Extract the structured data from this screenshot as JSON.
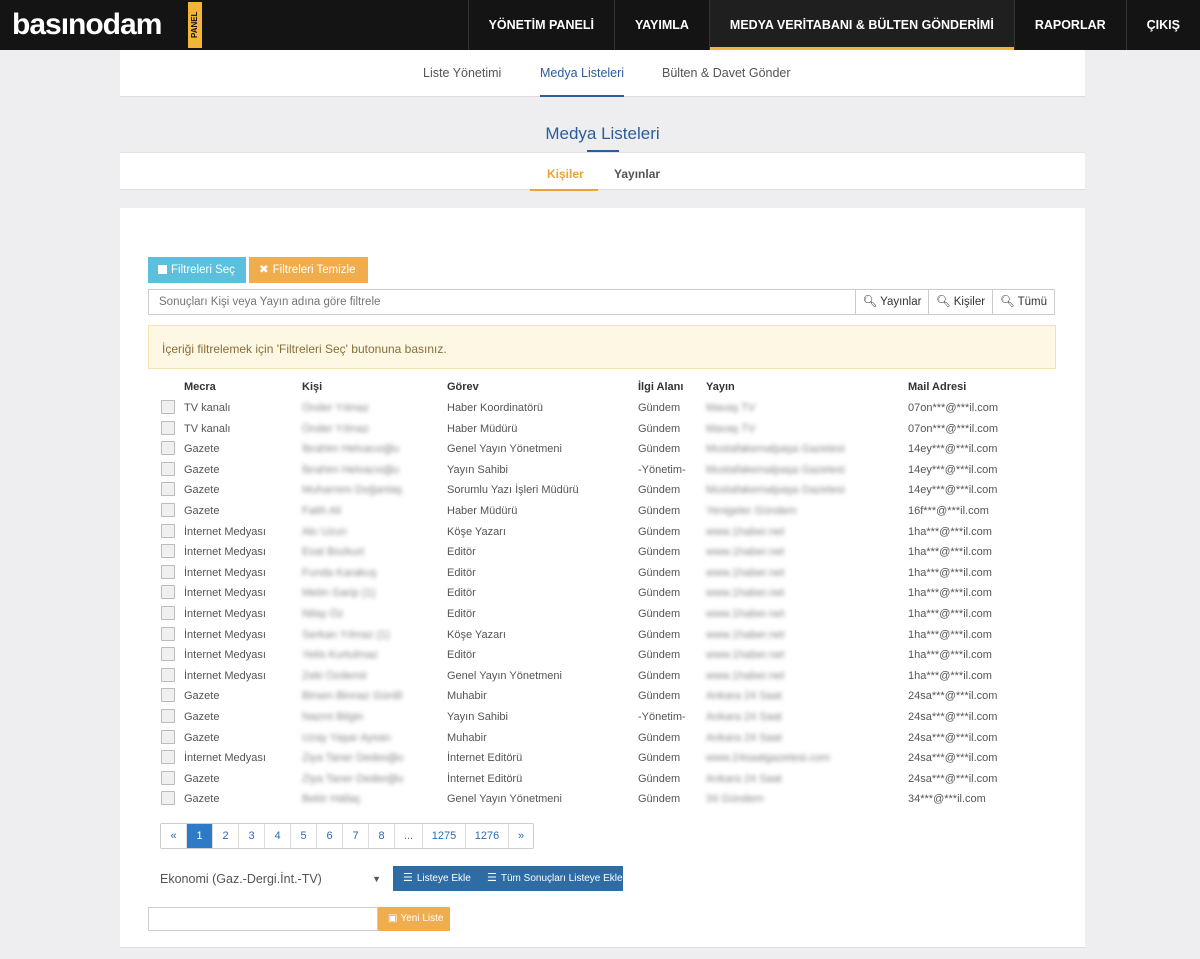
{
  "brand": {
    "logo": "basınodam",
    "badge": "PANEL"
  },
  "nav": [
    "YÖNETİM PANELİ",
    "YAYIMLA",
    "MEDYA VERİTABANI & BÜLTEN GÖNDERİMİ",
    "RAPORLAR",
    "ÇIKIŞ"
  ],
  "subtabs": [
    "Liste Yönetimi",
    "Medya Listeleri",
    "Bülten & Davet Gönder"
  ],
  "page_title": "Medya Listeleri",
  "tabs": [
    "Kişiler",
    "Yayınlar"
  ],
  "buttons": {
    "select_filters": "Filtreleri Seç",
    "clear_filters": "Filtreleri Temizle",
    "add_to_list": "Listeye Ekle",
    "add_all": "Tüm Sonuçları Listeye Ekle",
    "new_list": "Yeni Liste"
  },
  "search": {
    "placeholder": "Sonuçları Kişi veya Yayın adına göre filtrele",
    "btn_publications": "Yayınlar",
    "btn_people": "Kişiler",
    "btn_all": "Tümü"
  },
  "alert": "İçeriği filtrelemek için 'Filtreleri Seç' butonuna basınız.",
  "columns": [
    "Mecra",
    "Kişi",
    "Görev",
    "İlgi Alanı",
    "Yayın",
    "Mail Adresi"
  ],
  "rows": [
    [
      "TV kanalı",
      "Önder Yılmaz",
      "Haber Koordinatörü",
      "Gündem",
      "Mavaş TV",
      "07on***@***il.com"
    ],
    [
      "TV kanalı",
      "Önder Yılmaz",
      "Haber Müdürü",
      "Gündem",
      "Mavaş TV",
      "07on***@***il.com"
    ],
    [
      "Gazete",
      "İbrahim Helvacıoğlu",
      "Genel Yayın Yönetmeni",
      "Gündem",
      "Mustafakemalpaşa Gazetesi",
      "14ey***@***il.com"
    ],
    [
      "Gazete",
      "İbrahim Helvacıoğlu",
      "Yayın Sahibi",
      "-Yönetim-",
      "Mustafakemalpaşa Gazetesi",
      "14ey***@***il.com"
    ],
    [
      "Gazete",
      "Muharrem Doğantaş",
      "Sorumlu Yazı İşleri Müdürü",
      "Gündem",
      "Mustafakemalpaşa Gazetesi",
      "14ey***@***il.com"
    ],
    [
      "Gazete",
      "Fatih Ali",
      "Haber Müdürü",
      "Gündem",
      "Yenigeler Gündem",
      "16f***@***il.com"
    ],
    [
      "İnternet Medyası",
      "Akı Uzun",
      "Köşe Yazarı",
      "Gündem",
      "www.1haber.net",
      "1ha***@***il.com"
    ],
    [
      "İnternet Medyası",
      "Esat Bozkurt",
      "Editör",
      "Gündem",
      "www.1haber.net",
      "1ha***@***il.com"
    ],
    [
      "İnternet Medyası",
      "Funda Karakuş",
      "Editör",
      "Gündem",
      "www.1haber.net",
      "1ha***@***il.com"
    ],
    [
      "İnternet Medyası",
      "Metin Garip (1)",
      "Editör",
      "Gündem",
      "www.1haber.net",
      "1ha***@***il.com"
    ],
    [
      "İnternet Medyası",
      "Nilay Öz",
      "Editör",
      "Gündem",
      "www.1haber.net",
      "1ha***@***il.com"
    ],
    [
      "İnternet Medyası",
      "Serkan Yılmaz (1)",
      "Köşe Yazarı",
      "Gündem",
      "www.1haber.net",
      "1ha***@***il.com"
    ],
    [
      "İnternet Medyası",
      "Yetis Kurtulmaz",
      "Editör",
      "Gündem",
      "www.1haber.net",
      "1ha***@***il.com"
    ],
    [
      "İnternet Medyası",
      "Zeki Özdemir",
      "Genel Yayın Yönetmeni",
      "Gündem",
      "www.1haber.net",
      "1ha***@***il.com"
    ],
    [
      "Gazete",
      "Birsen Binnaz Gürdil",
      "Muhabir",
      "Gündem",
      "Ankara 24 Saat",
      "24sa***@***il.com"
    ],
    [
      "Gazete",
      "Nazmi Bilgin",
      "Yayın Sahibi",
      "-Yönetim-",
      "Ankara 24 Saat",
      "24sa***@***il.com"
    ],
    [
      "Gazete",
      "Uzay Yaşar Aysan",
      "Muhabir",
      "Gündem",
      "Ankara 24 Saat",
      "24sa***@***il.com"
    ],
    [
      "İnternet Medyası",
      "Ziya Taner Dedeoğlu",
      "İnternet Editörü",
      "Gündem",
      "www.24saatgazetesi.com",
      "24sa***@***il.com"
    ],
    [
      "Gazete",
      "Ziya Taner Dedeoğlu",
      "İnternet Editörü",
      "Gündem",
      "Ankara 24 Saat",
      "24sa***@***il.com"
    ],
    [
      "Gazete",
      "Bekir Hallaç",
      "Genel Yayın Yönetmeni",
      "Gündem",
      "34 Gündem",
      "34***@***il.com"
    ]
  ],
  "pagination": [
    "«",
    "1",
    "2",
    "3",
    "4",
    "5",
    "6",
    "7",
    "8",
    "...",
    "1275",
    "1276",
    "»"
  ],
  "list_select": "Ekonomi (Gaz.-Dergi.İnt.-TV)"
}
